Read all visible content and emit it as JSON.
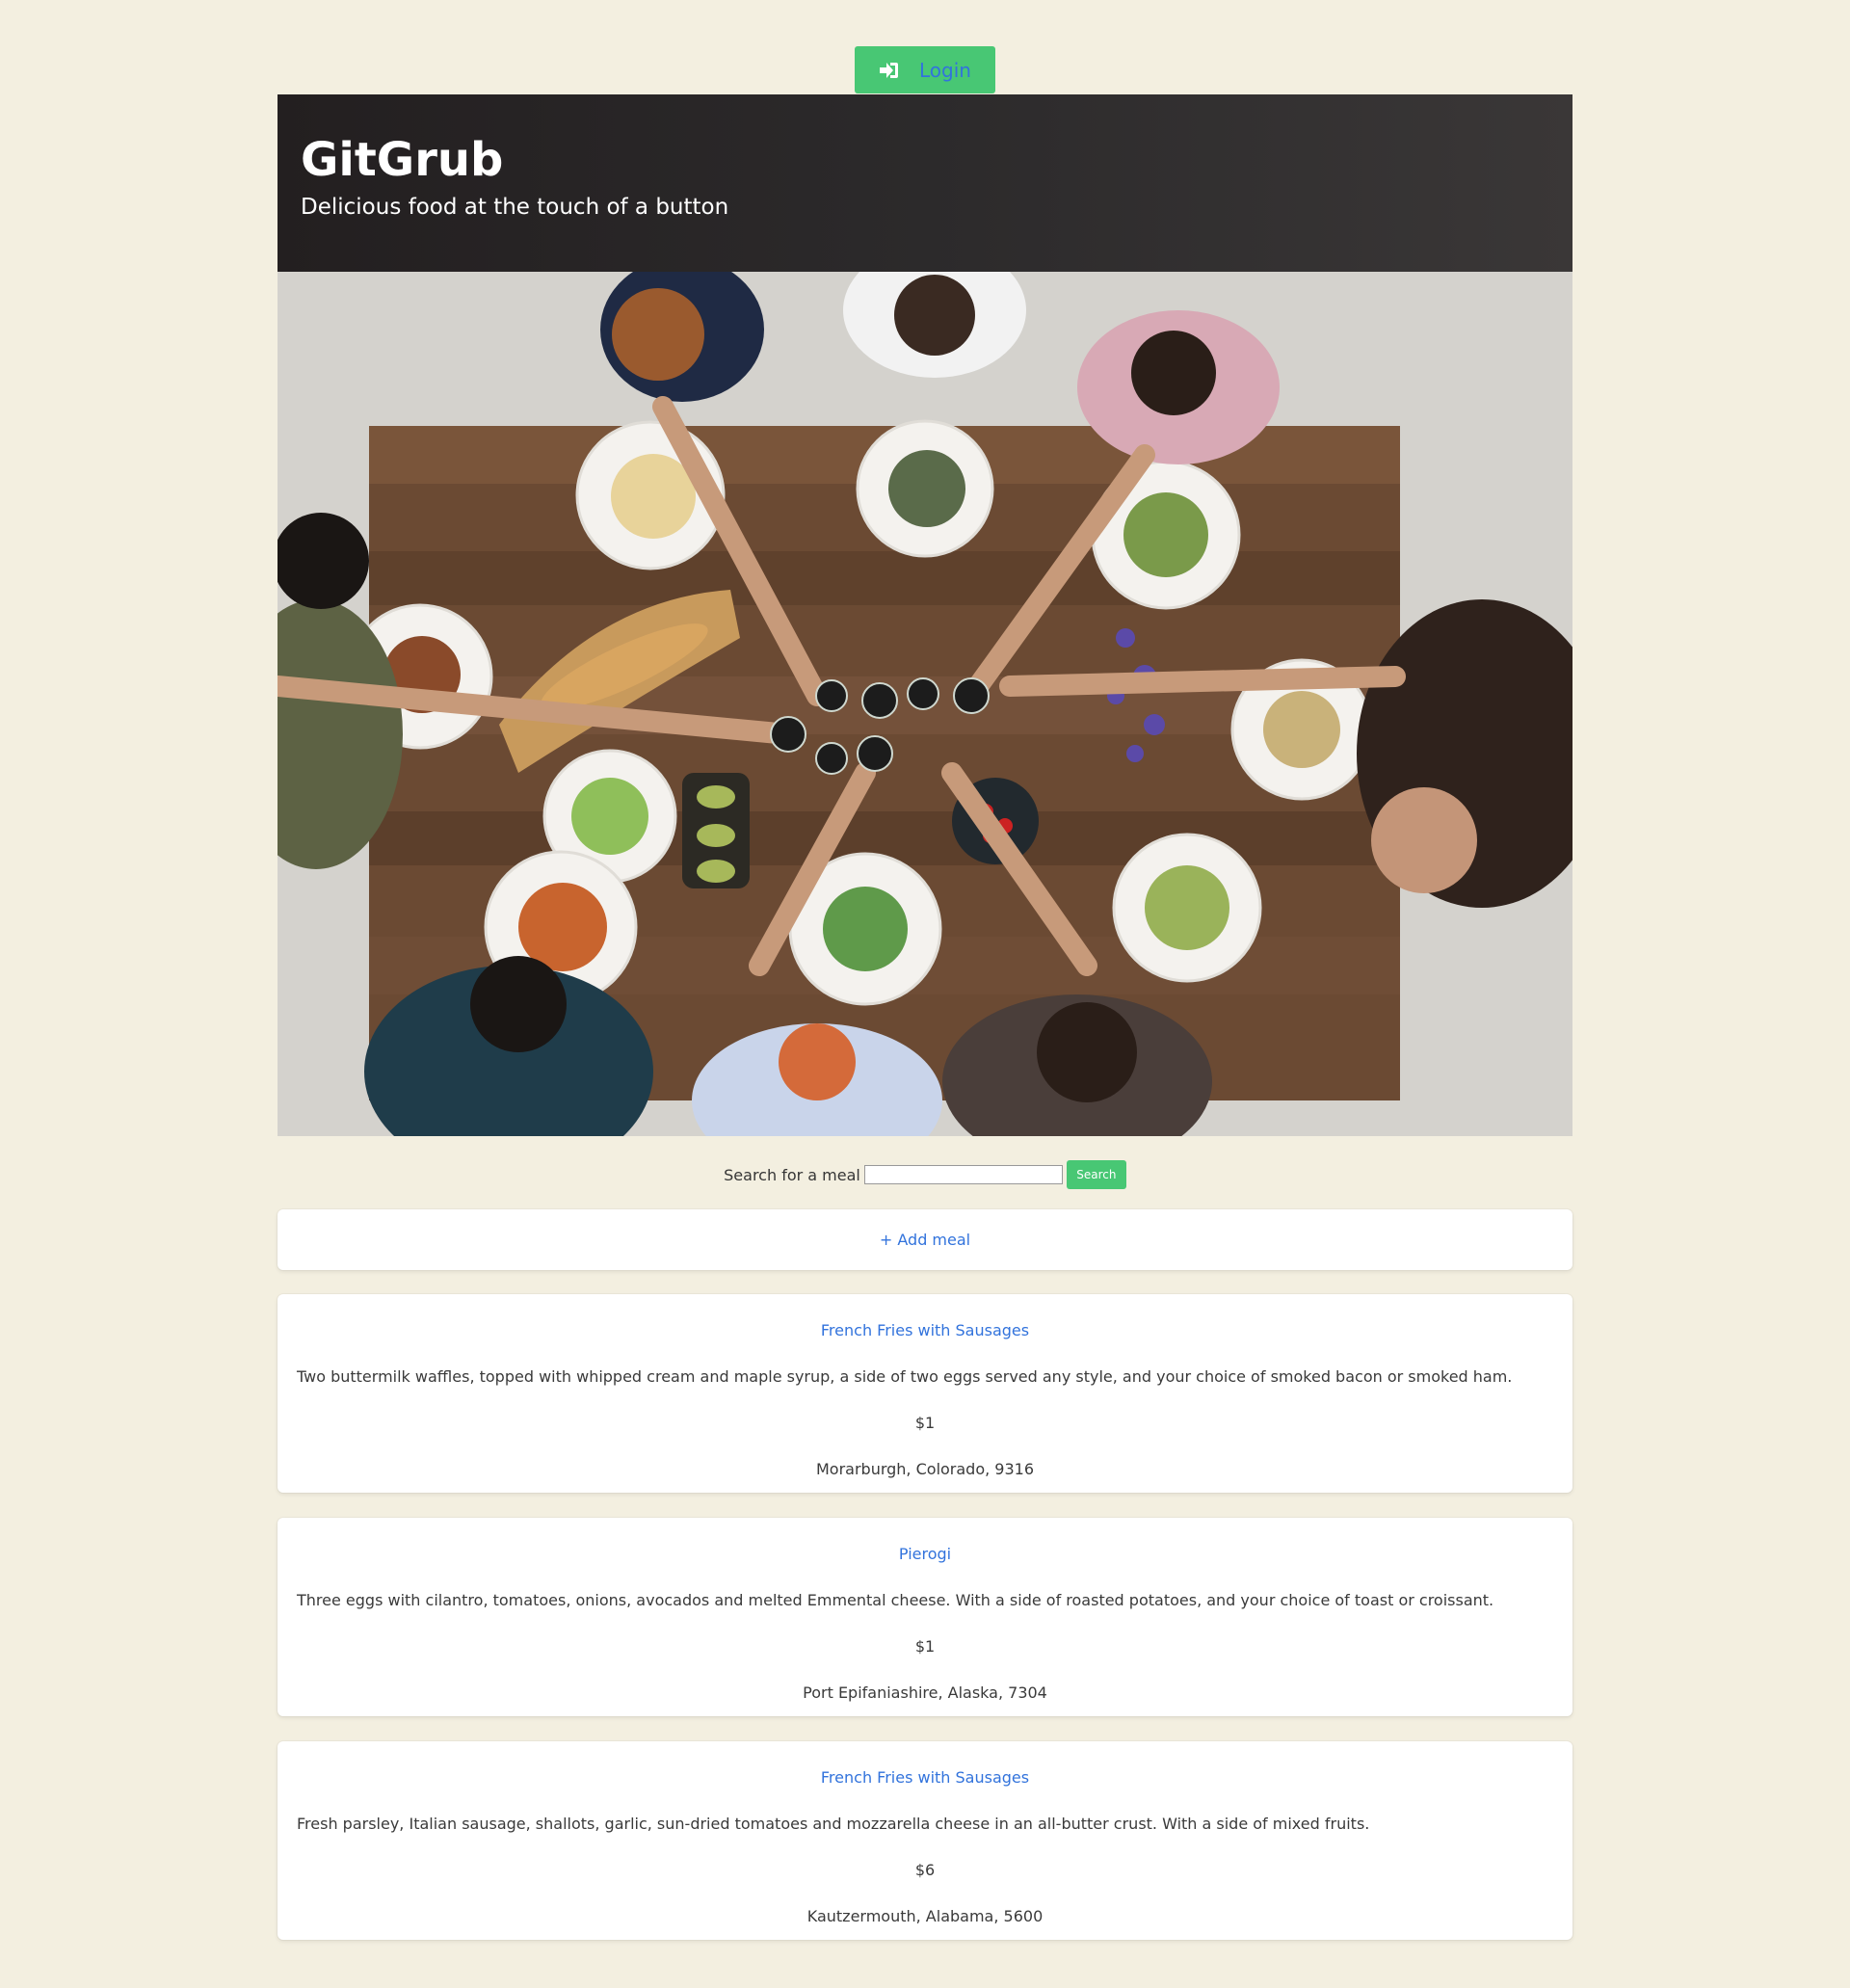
{
  "header": {
    "login_label": "Login"
  },
  "hero": {
    "title": "GitGrub",
    "subtitle": "Delicious food at the touch of a button"
  },
  "search": {
    "label": "Search for a meal",
    "value": "",
    "button_label": "Search"
  },
  "add_meal": {
    "label": "+ Add meal"
  },
  "meals": [
    {
      "title": "French Fries with Sausages",
      "description": "Two buttermilk waffles, topped with whipped cream and maple syrup, a side of two eggs served any style, and your choice of smoked bacon or smoked ham.",
      "price": "$1",
      "location": "Morarburgh, Colorado, 9316"
    },
    {
      "title": "Pierogi",
      "description": "Three eggs with cilantro, tomatoes, onions, avocados and melted Emmental cheese. With a side of roasted potatoes, and your choice of toast or croissant.",
      "price": "$1",
      "location": "Port Epifaniashire, Alaska, 7304"
    },
    {
      "title": "French Fries with Sausages",
      "description": "Fresh parsley, Italian sausage, shallots, garlic, sun-dried tomatoes and mozzarella cheese in an all-butter crust. With a side of mixed fruits.",
      "price": "$6",
      "location": "Kautzermouth, Alabama, 5600"
    }
  ],
  "colors": {
    "background": "#f3efe0",
    "primary_green": "#48c774",
    "link_blue": "#3273dc",
    "hero_dark": "#231f20"
  },
  "icons": {
    "login": "sign-in-icon"
  }
}
